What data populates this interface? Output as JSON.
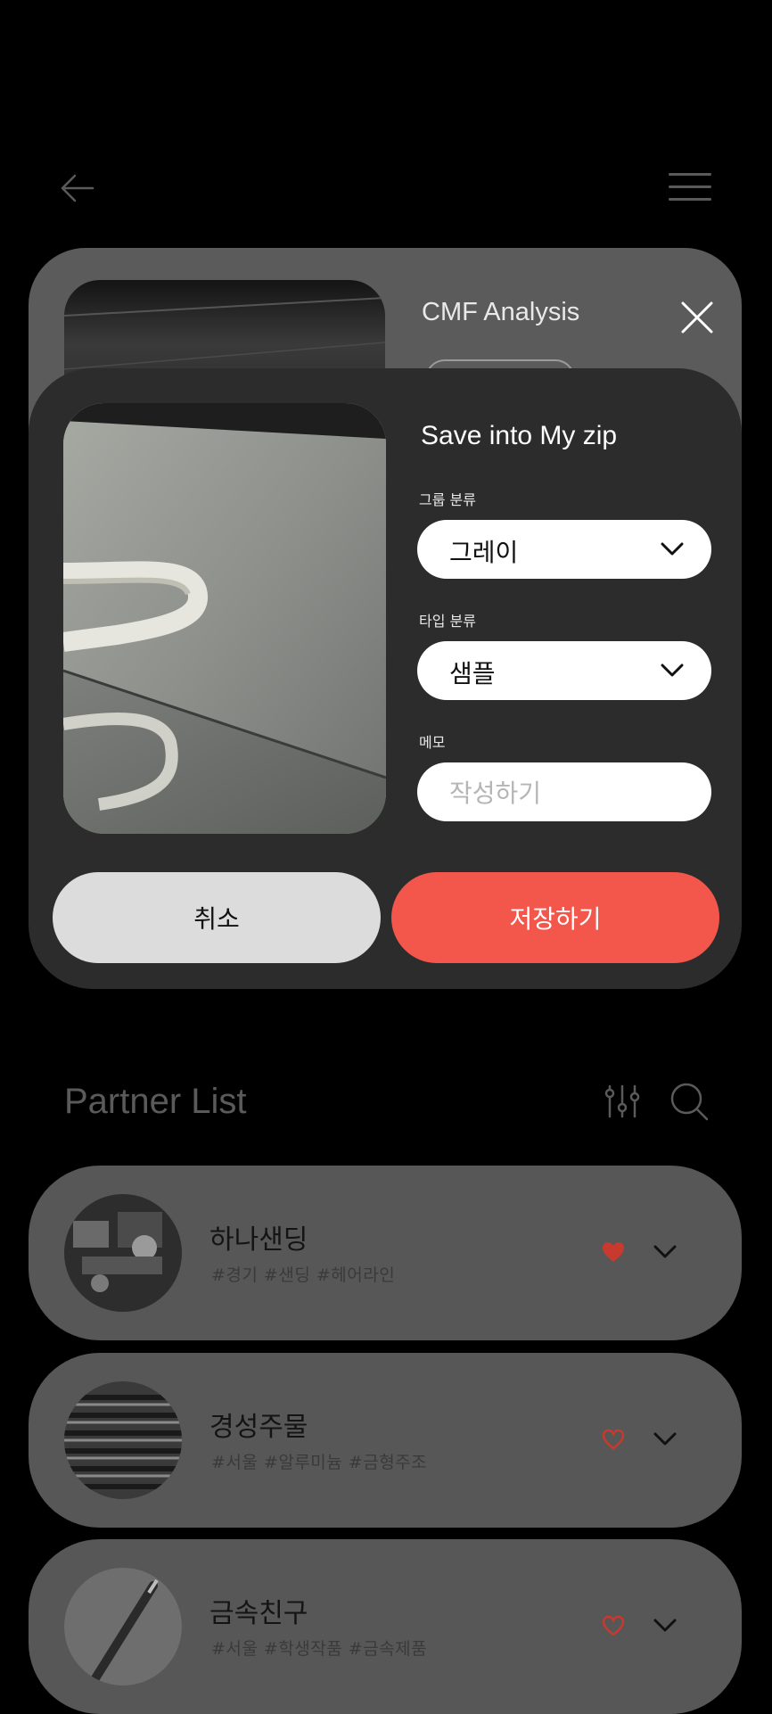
{
  "background_card": {
    "title": "CMF Analysis"
  },
  "modal": {
    "title": "Save into My zip",
    "group": {
      "label": "그룹 분류",
      "value": "그레이"
    },
    "type": {
      "label": "타입 분류",
      "value": "샘플"
    },
    "memo": {
      "label": "메모",
      "placeholder": "작성하기"
    },
    "cancel_label": "취소",
    "save_label": "저장하기"
  },
  "partner_list": {
    "title": "Partner List",
    "items": [
      {
        "name": "하나샌딩",
        "tags": "#경기  #샌딩  #헤어라인",
        "favorite": true
      },
      {
        "name": "경성주물",
        "tags": "#서울  #알루미늄  #금형주조",
        "favorite": false
      },
      {
        "name": "금속친구",
        "tags": "#서울  #학생작품  #금속제품",
        "favorite": false
      }
    ]
  },
  "colors": {
    "accent": "#f3564b",
    "modal_bg": "#2c2c2c",
    "dim_card": "#575757",
    "heart": "#c8392e"
  },
  "icons": [
    "back-arrow-icon",
    "menu-icon",
    "close-icon",
    "chevron-down-icon",
    "filter-icon",
    "search-icon",
    "heart-icon"
  ]
}
